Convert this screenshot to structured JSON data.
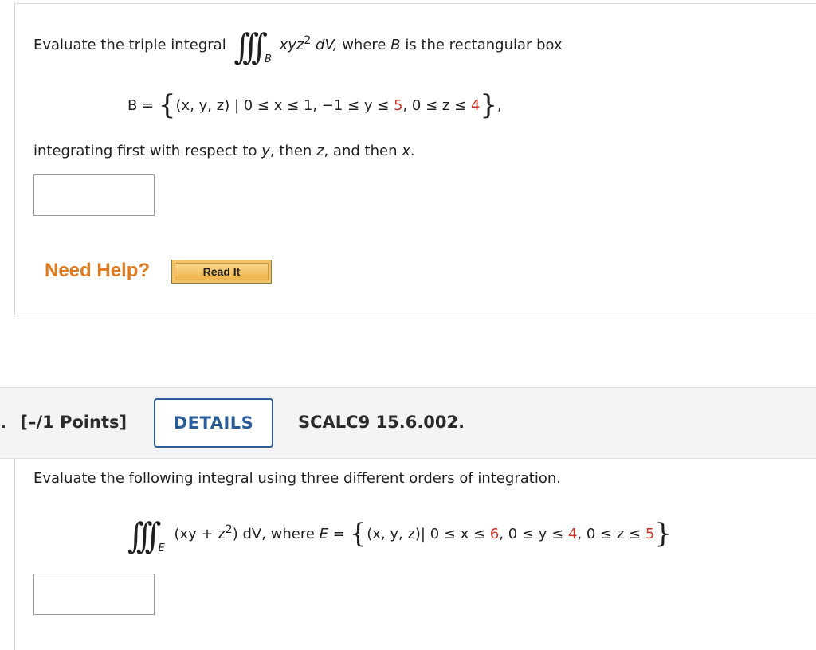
{
  "q1": {
    "intro": "Evaluate the triple integral",
    "integrand": "xyz",
    "exponent": "2",
    "dV": "dV,",
    "tail": "where",
    "B": "B",
    "tail2": "is the rectangular box",
    "region_sub": "B",
    "set_lhs": "B =",
    "set_vars": "(x, y, z) | 0 ≤ x ≤ 1, −1 ≤ y ≤",
    "y_upper": "5",
    "set_mid": ", 0 ≤ z ≤",
    "z_upper": "4",
    "set_end": ",",
    "order_pre": "integrating first with respect to",
    "v1": "y",
    "comma_then": ", then",
    "v2": "z",
    "and_then": ", and then",
    "v3": "x",
    "period": ".",
    "need_help": "Need Help?",
    "read_it": "Read It"
  },
  "q2": {
    "number": ".",
    "points": "[–/1 Points]",
    "details": "DETAILS",
    "code": "SCALC9 15.6.002.",
    "prompt": "Evaluate the following integral using three different orders of integration.",
    "integrand": "(xy + z",
    "exponent": "2",
    "integrand_end": ") dV, where",
    "E": "E",
    "eq": " =",
    "region_sub": "E",
    "set_vars": "(x, y, z)| 0 ≤ x ≤",
    "x_upper": "6",
    "set_mid1": ", 0 ≤ y ≤",
    "y_upper": "4",
    "set_mid2": ", 0 ≤ z ≤",
    "z_upper": "5"
  },
  "colors": {
    "accent_red": "#c8362a",
    "help_orange": "#e07a1f",
    "details_blue": "#2a5d98"
  }
}
